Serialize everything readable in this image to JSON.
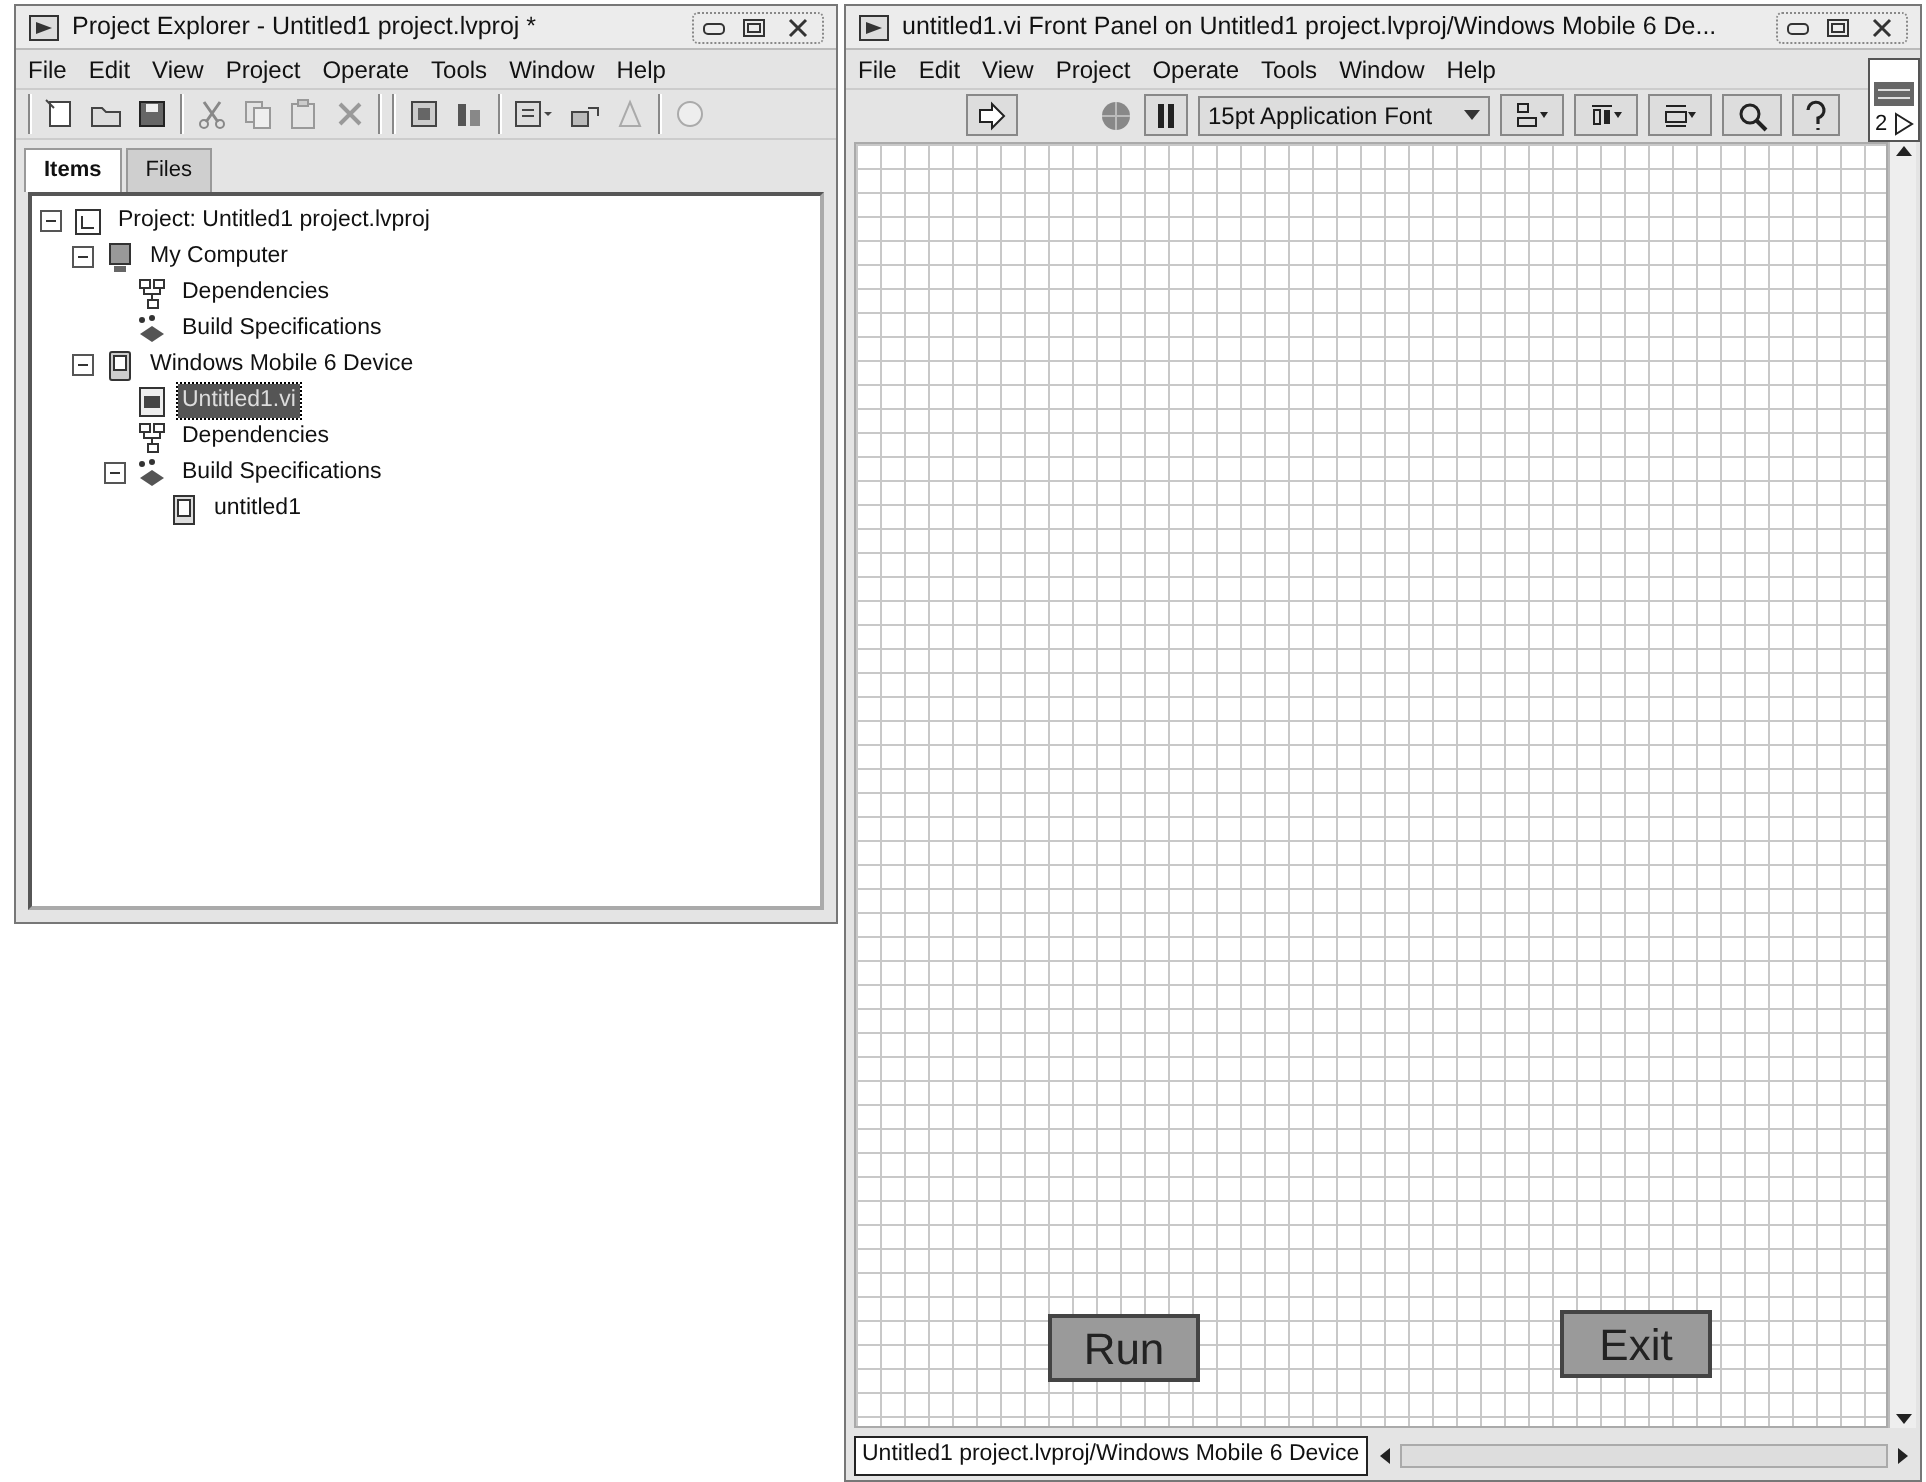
{
  "project_window": {
    "title": "Project Explorer - Untitled1 project.lvproj *",
    "menu": [
      "File",
      "Edit",
      "View",
      "Project",
      "Operate",
      "Tools",
      "Window",
      "Help"
    ],
    "tabs": [
      {
        "label": "Items",
        "selected": true
      },
      {
        "label": "Files",
        "selected": false
      }
    ],
    "tree": [
      {
        "label": "Project: Untitled1 project.lvproj",
        "kind": "project",
        "expanded": true,
        "selected": false,
        "children": [
          {
            "label": "My Computer",
            "kind": "computer",
            "expanded": true,
            "selected": false,
            "children": [
              {
                "label": "Dependencies",
                "kind": "dependencies",
                "selected": false
              },
              {
                "label": "Build Specifications",
                "kind": "build",
                "selected": false
              }
            ]
          },
          {
            "label": "Windows Mobile 6 Device",
            "kind": "device",
            "expanded": true,
            "selected": false,
            "children": [
              {
                "label": "Untitled1.vi",
                "kind": "vi",
                "selected": true
              },
              {
                "label": "Dependencies",
                "kind": "dependencies",
                "selected": false
              },
              {
                "label": "Build Specifications",
                "kind": "build",
                "expanded": true,
                "selected": false,
                "children": [
                  {
                    "label": "untitled1",
                    "kind": "app",
                    "selected": false
                  }
                ]
              }
            ]
          }
        ]
      }
    ]
  },
  "front_panel": {
    "title": "untitled1.vi Front Panel on Untitled1 project.lvproj/Windows Mobile 6 De...",
    "menu": [
      "File",
      "Edit",
      "View",
      "Project",
      "Operate",
      "Tools",
      "Window",
      "Help"
    ],
    "font_dropdown": "15pt Application Font",
    "connector_label": "2",
    "buttons": [
      {
        "label": "Run"
      },
      {
        "label": "Exit"
      }
    ],
    "context_path": "Untitled1 project.lvproj/Windows Mobile 6 Device"
  }
}
